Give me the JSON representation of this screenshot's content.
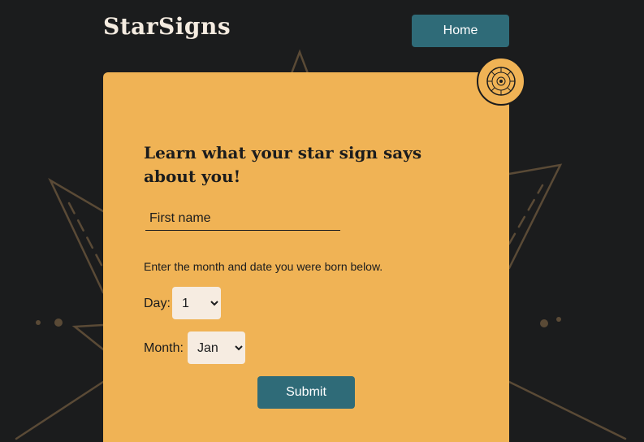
{
  "header": {
    "logo_text": "StarSigns",
    "home_label": "Home"
  },
  "badge": {
    "icon": "zodiac-wheel-icon"
  },
  "form": {
    "heading": "Learn what your star sign says about you!",
    "first_name_placeholder": "First name",
    "first_name_value": "",
    "instructions": "Enter the month and date you were born below.",
    "day_label": "Day:",
    "day_value": "1",
    "month_label": "Month:",
    "month_value": "Jan",
    "submit_label": "Submit"
  },
  "colors": {
    "background": "#1b1c1d",
    "card": "#f0b355",
    "button": "#2f6b78",
    "select_bg": "#f6ece1",
    "text_light": "#f4ebe0",
    "star_line": "#5a4a36"
  }
}
